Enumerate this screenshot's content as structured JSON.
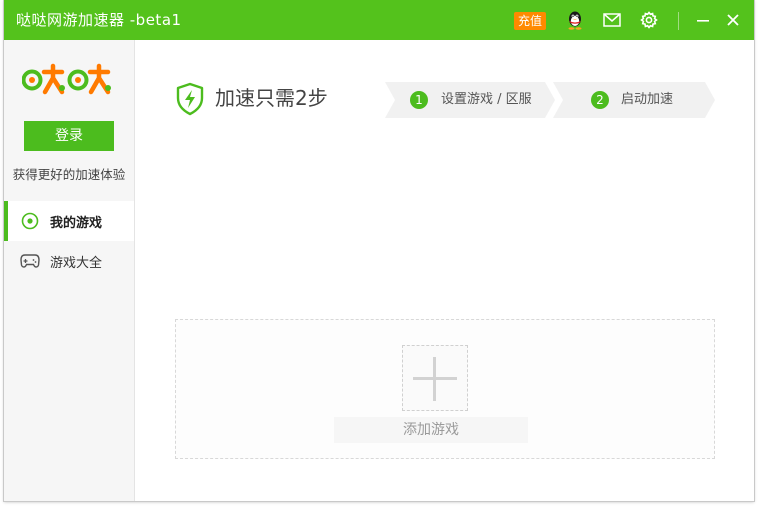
{
  "window": {
    "title": "哒哒网游加速器 -beta1",
    "recharge_label": "充值"
  },
  "icons": {
    "qq": "qq-penguin-icon",
    "mail": "mail-icon",
    "settings": "gear-icon",
    "minimize": "minimize-icon",
    "close": "close-icon"
  },
  "sidebar": {
    "logo_text": "哒哒",
    "login_label": "登录",
    "slogan": "获得更好的加速体验",
    "items": [
      {
        "label": "我的游戏",
        "icon": "my-games-icon",
        "active": true
      },
      {
        "label": "游戏大全",
        "icon": "gamepad-icon",
        "active": false
      }
    ]
  },
  "main": {
    "heading": "加速只需2步",
    "steps": [
      {
        "num": "1",
        "label": "设置游戏 / 区服"
      },
      {
        "num": "2",
        "label": "启动加速"
      }
    ],
    "add_game_label": "添加游戏"
  },
  "colors": {
    "brand_green": "#54c21c",
    "button_green": "#4cbc1e",
    "recharge_orange": "#ff8a00"
  }
}
